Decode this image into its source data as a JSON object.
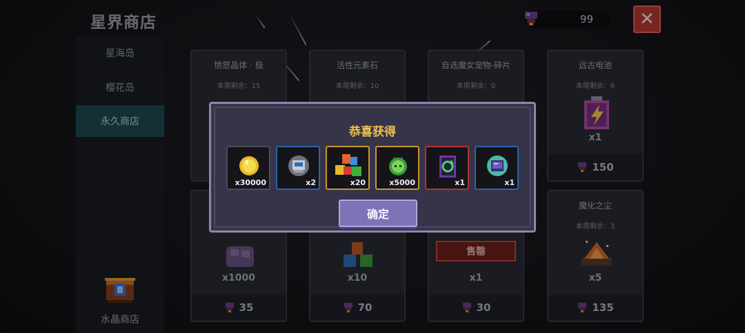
{
  "header": {
    "title": "星界商店",
    "currency_value": "99",
    "close_label": "✕"
  },
  "sidebar": {
    "items": [
      {
        "label": "星海岛",
        "active": false
      },
      {
        "label": "樱花岛",
        "active": false
      },
      {
        "label": "永久商店",
        "active": true
      }
    ],
    "crystal_shop_label": "水晶商店"
  },
  "shop": {
    "cards": [
      {
        "name": "愤怒晶体 · 极",
        "remaining": "本周剩余：15"
      },
      {
        "name": "活性元素石",
        "remaining": "本周剩余：10"
      },
      {
        "name": "自选魔女宠物-碎片",
        "remaining": "本周剩余：0"
      },
      {
        "name": "远古电池",
        "remaining": "本周剩余：6",
        "qty": "x1",
        "price": "150"
      },
      {
        "qty": "x1000",
        "price": "35"
      },
      {
        "qty": "x10",
        "price": "70"
      },
      {
        "qty": "x1",
        "price": "30",
        "sold_label": "售罄"
      },
      {
        "name": "魔化之尘",
        "remaining": "本周剩余：3",
        "qty": "x5",
        "price": "135"
      }
    ]
  },
  "modal": {
    "title": "恭喜获得",
    "confirm_label": "确定",
    "rewards": [
      {
        "qty": "x30000",
        "icon": "gold-coin-icon"
      },
      {
        "qty": "x2",
        "icon": "robot-icon"
      },
      {
        "qty": "x20",
        "icon": "element-stones-icon"
      },
      {
        "qty": "x5000",
        "icon": "green-cat-coin-icon"
      },
      {
        "qty": "x1",
        "icon": "refresh-card-icon"
      },
      {
        "qty": "x1",
        "icon": "tablet-icon"
      }
    ]
  },
  "colors": {
    "accent_gold": "#f0c04a",
    "sold_red": "#c2453a",
    "confirm_purple": "#7d74b8",
    "active_tab": "#1f4a55"
  }
}
